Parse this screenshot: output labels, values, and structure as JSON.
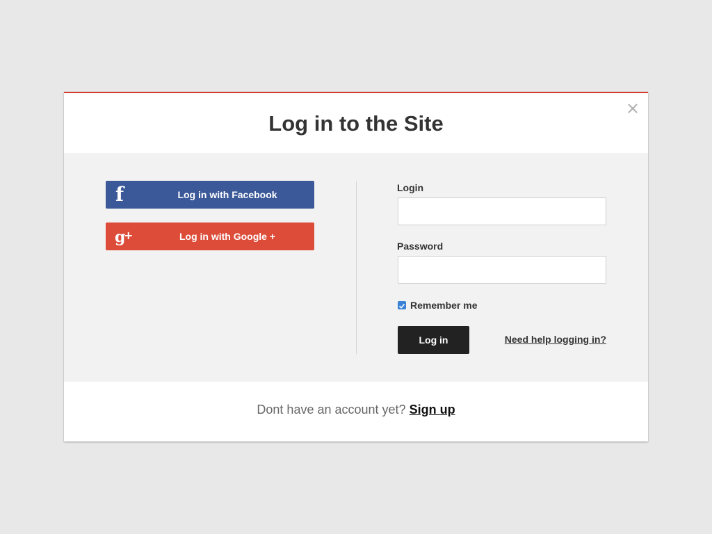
{
  "modal": {
    "title": "Log in to the Site",
    "accent_color": "#d33b2c",
    "close_icon": "close-icon"
  },
  "social": {
    "facebook": {
      "label": "Log in with Facebook",
      "icon": "facebook-icon",
      "color": "#3b5998"
    },
    "google": {
      "label": "Log in with Google +",
      "icon": "google-plus-icon",
      "color": "#dd4b39"
    }
  },
  "form": {
    "login_label": "Login",
    "login_value": "",
    "password_label": "Password",
    "password_value": "",
    "remember_label": "Remember me",
    "remember_checked": true,
    "submit_label": "Log in",
    "help_link": "Need help logging in?"
  },
  "footer": {
    "prompt": "Dont have an account yet?",
    "signup_label": "Sign up"
  }
}
